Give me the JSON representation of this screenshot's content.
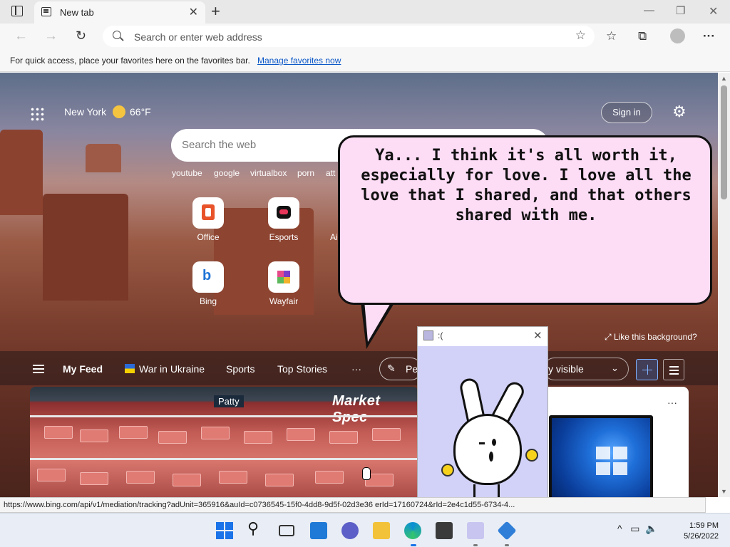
{
  "browser": {
    "tab_title": "New tab",
    "address_placeholder": "Search or enter web address",
    "favorites_message": "For quick access, place your favorites here on the favorites bar.",
    "favorites_link": "Manage favorites now"
  },
  "header": {
    "location": "New York",
    "temperature": "66°F",
    "sign_in": "Sign in",
    "search_placeholder": "Search the web"
  },
  "quick_links": [
    "youtube",
    "google",
    "virtualbox",
    "porn",
    "att e"
  ],
  "tiles": [
    {
      "label": "Office",
      "icon": "office-icon"
    },
    {
      "label": "Esports",
      "icon": "gamepad-icon"
    },
    {
      "label": "Ai",
      "icon": "app-icon"
    },
    {
      "label": "Bing",
      "icon": "bing-icon"
    },
    {
      "label": "Wayfair",
      "icon": "wayfair-icon"
    }
  ],
  "like_background": "Like this background?",
  "feed": {
    "items": [
      "My Feed",
      "War in Ukraine",
      "Sports",
      "Top Stories",
      "···"
    ],
    "personalize": "Pe",
    "visibility": "y visible"
  },
  "card1": {
    "sign": "Market Spec",
    "label": "Patty"
  },
  "bubble": {
    "text": "Ya... I think it's all worth it, especially for love. I love all the love that I shared, and that others shared with me."
  },
  "pet_window": {
    "title": ":("
  },
  "status_url": "https://www.bing.com/api/v1/mediation/tracking?adUnit=365916&auId=c0736545-15f0-4dd8-9d5f-02d3e36                                                                                  erId=17160724&rId=2e4c1d55-6734-4...",
  "taskbar": {
    "time": "1:59 PM",
    "date": "5/26/2022"
  }
}
